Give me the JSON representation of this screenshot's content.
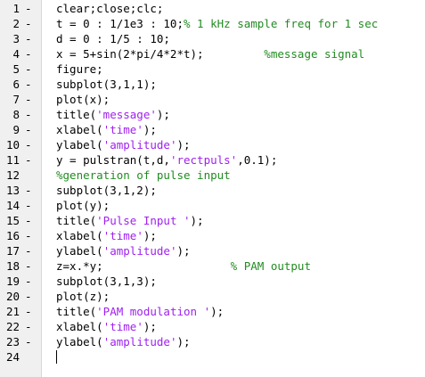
{
  "colors": {
    "code": "#000000",
    "string": "#a020f0",
    "comment": "#228b22",
    "gutter": "#f0f0f0"
  },
  "lines": [
    {
      "number": "1",
      "marker": "-",
      "segments": [
        {
          "type": "code",
          "text": "clear;close;clc;"
        }
      ]
    },
    {
      "number": "2",
      "marker": "-",
      "segments": [
        {
          "type": "code",
          "text": "t = 0 : 1/1e3 : 10;"
        },
        {
          "type": "comment",
          "text": "% 1 kHz sample freq for 1 sec"
        }
      ]
    },
    {
      "number": "3",
      "marker": "-",
      "segments": [
        {
          "type": "code",
          "text": "d = 0 : 1/5 : 10;"
        }
      ]
    },
    {
      "number": "4",
      "marker": "-",
      "segments": [
        {
          "type": "code",
          "text": "x = 5+sin(2*pi/4*2*t);         "
        },
        {
          "type": "comment",
          "text": "%message signal"
        }
      ]
    },
    {
      "number": "5",
      "marker": "-",
      "segments": [
        {
          "type": "code",
          "text": "figure;"
        }
      ]
    },
    {
      "number": "6",
      "marker": "-",
      "segments": [
        {
          "type": "code",
          "text": "subplot(3,1,1);"
        }
      ]
    },
    {
      "number": "7",
      "marker": "-",
      "segments": [
        {
          "type": "code",
          "text": "plot(x);"
        }
      ]
    },
    {
      "number": "8",
      "marker": "-",
      "segments": [
        {
          "type": "code",
          "text": "title("
        },
        {
          "type": "str",
          "text": "'message'"
        },
        {
          "type": "code",
          "text": ");"
        }
      ]
    },
    {
      "number": "9",
      "marker": "-",
      "segments": [
        {
          "type": "code",
          "text": "xlabel("
        },
        {
          "type": "str",
          "text": "'time'"
        },
        {
          "type": "code",
          "text": ");"
        }
      ]
    },
    {
      "number": "10",
      "marker": "-",
      "segments": [
        {
          "type": "code",
          "text": "ylabel("
        },
        {
          "type": "str",
          "text": "'amplitude'"
        },
        {
          "type": "code",
          "text": ");"
        }
      ]
    },
    {
      "number": "11",
      "marker": "-",
      "segments": [
        {
          "type": "code",
          "text": "y = pulstran(t,d,"
        },
        {
          "type": "str",
          "text": "'rectpuls'"
        },
        {
          "type": "code",
          "text": ",0.1);"
        }
      ]
    },
    {
      "number": "12",
      "marker": "",
      "segments": [
        {
          "type": "comment",
          "text": "%generation of pulse input"
        }
      ]
    },
    {
      "number": "13",
      "marker": "-",
      "segments": [
        {
          "type": "code",
          "text": "subplot(3,1,2);"
        }
      ]
    },
    {
      "number": "14",
      "marker": "-",
      "segments": [
        {
          "type": "code",
          "text": "plot(y);"
        }
      ]
    },
    {
      "number": "15",
      "marker": "-",
      "segments": [
        {
          "type": "code",
          "text": "title("
        },
        {
          "type": "str",
          "text": "'Pulse Input '"
        },
        {
          "type": "code",
          "text": ");"
        }
      ]
    },
    {
      "number": "16",
      "marker": "-",
      "segments": [
        {
          "type": "code",
          "text": "xlabel("
        },
        {
          "type": "str",
          "text": "'time'"
        },
        {
          "type": "code",
          "text": ");"
        }
      ]
    },
    {
      "number": "17",
      "marker": "-",
      "segments": [
        {
          "type": "code",
          "text": "ylabel("
        },
        {
          "type": "str",
          "text": "'amplitude'"
        },
        {
          "type": "code",
          "text": ");"
        }
      ]
    },
    {
      "number": "18",
      "marker": "-",
      "segments": [
        {
          "type": "code",
          "text": "z=x.*y;                   "
        },
        {
          "type": "comment",
          "text": "% PAM output"
        }
      ]
    },
    {
      "number": "19",
      "marker": "-",
      "segments": [
        {
          "type": "code",
          "text": "subplot(3,1,3);"
        }
      ]
    },
    {
      "number": "20",
      "marker": "-",
      "segments": [
        {
          "type": "code",
          "text": "plot(z);"
        }
      ]
    },
    {
      "number": "21",
      "marker": "-",
      "segments": [
        {
          "type": "code",
          "text": "title("
        },
        {
          "type": "str",
          "text": "'PAM modulation '"
        },
        {
          "type": "code",
          "text": ");"
        }
      ]
    },
    {
      "number": "22",
      "marker": "-",
      "segments": [
        {
          "type": "code",
          "text": "xlabel("
        },
        {
          "type": "str",
          "text": "'time'"
        },
        {
          "type": "code",
          "text": ");"
        }
      ]
    },
    {
      "number": "23",
      "marker": "-",
      "segments": [
        {
          "type": "code",
          "text": "ylabel("
        },
        {
          "type": "str",
          "text": "'amplitude'"
        },
        {
          "type": "code",
          "text": ");"
        }
      ]
    },
    {
      "number": "24",
      "marker": "",
      "segments": []
    }
  ]
}
